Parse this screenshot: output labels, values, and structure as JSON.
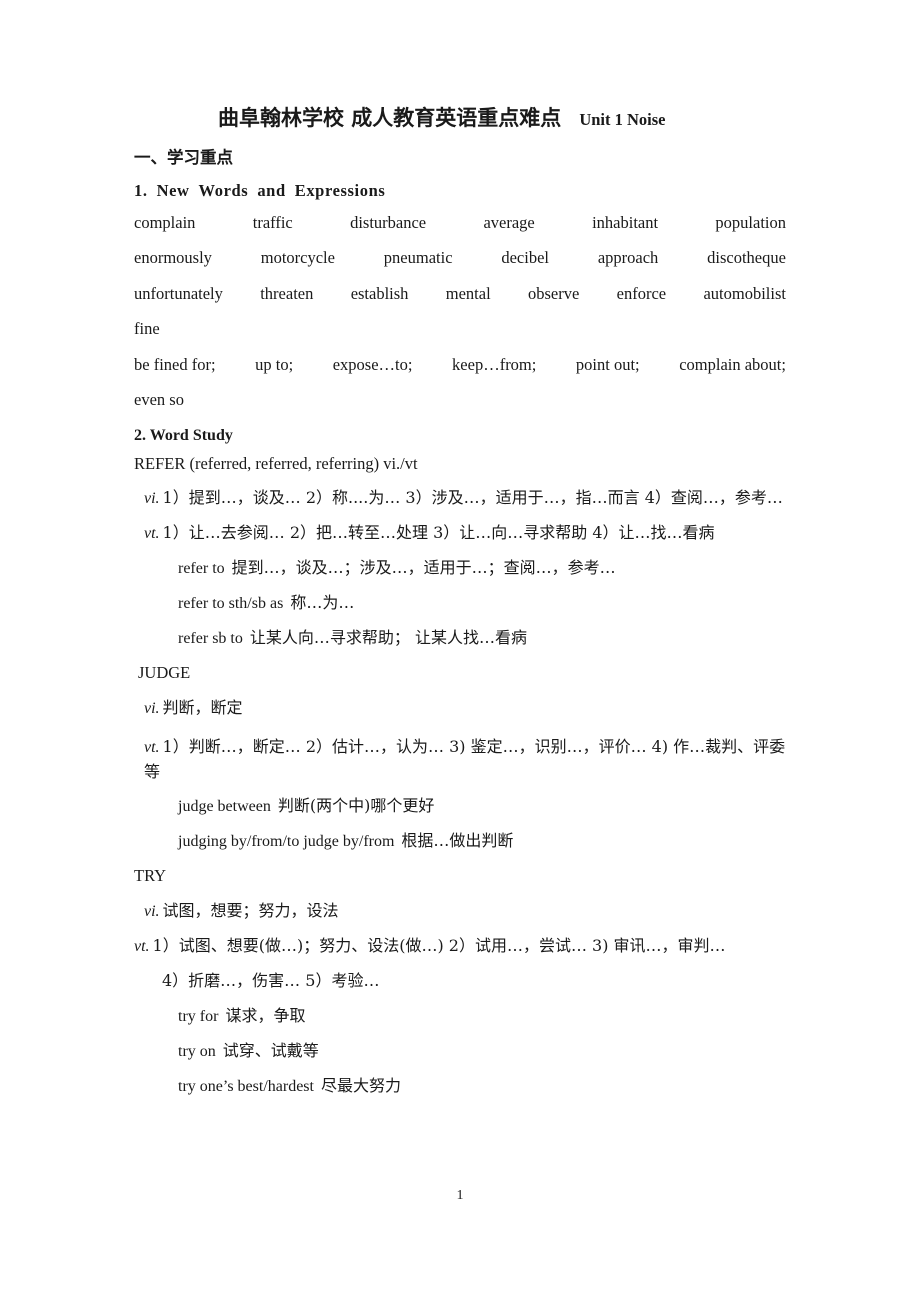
{
  "document": {
    "title_cn": "曲阜翰林学校   成人教育英语重点难点",
    "title_en": "Unit 1 Noise",
    "page_number": "1"
  },
  "section_one": {
    "heading": "一、学习重点",
    "subsection_1_heading_parts": [
      "1.",
      "New",
      "Words",
      "and",
      "Expressions"
    ],
    "word_rows": [
      [
        "complain",
        "traffic",
        "disturbance",
        "average",
        "inhabitant",
        "population"
      ],
      [
        "enormously",
        "motorcycle",
        "pneumatic",
        "decibel",
        "approach",
        "discotheque"
      ],
      [
        "unfortunately",
        "threaten",
        "establish",
        "mental",
        "observe",
        "enforce",
        "automobilist"
      ],
      [
        "fine"
      ]
    ],
    "phrase_rows": [
      [
        "be fined for;",
        "up to;",
        "expose…to;",
        "keep…from;",
        "point out;",
        "complain about;"
      ],
      [
        "even so"
      ]
    ]
  },
  "section_two": {
    "heading": "2. Word Study",
    "entries": [
      {
        "headword": "REFER (referred, referred, referring) vi./vt",
        "senses": [
          {
            "pos": "vi.",
            "text": "1）提到…，谈及… 2）称....为… 3）涉及…，适用于…，指…而言   4）查阅…，参考…"
          },
          {
            "pos": "vt.",
            "text": "1）让…去参阅…   2）把…转至…处理   3）让…向…寻求帮助 4）让…找…看病"
          }
        ],
        "collocations": [
          {
            "en": "refer to",
            "cn": "提到…，谈及…；涉及…，适用于…；查阅…，参考…"
          },
          {
            "en": "refer to sth/sb as",
            "cn": "称…为…"
          },
          {
            "en": "refer sb to",
            "cn": "让某人向…寻求帮助；  让某人找…看病"
          }
        ]
      },
      {
        "headword": "JUDGE",
        "senses": [
          {
            "pos": "vi.",
            "text": "判断，断定"
          },
          {
            "pos": "vt.",
            "text": "1）判断…，断定… 2）估计…，认为… 3) 鉴定…，识别…，评价… 4) 作…裁判、评委等"
          }
        ],
        "collocations": [
          {
            "en": "judge between",
            "cn": "判断(两个中)哪个更好"
          },
          {
            "en": "judging by/from/to judge by/from",
            "cn": "根据…做出判断"
          }
        ]
      },
      {
        "headword": "TRY",
        "senses": [
          {
            "pos": "vi.",
            "text": "试图，想要；努力，设法"
          },
          {
            "pos": "vt.",
            "text": "1）试图、想要(做…)；努力、设法(做…)   2）试用…，尝试… 3) 审讯…，审判…"
          },
          {
            "pos": "",
            "text": "4）折磨…，伤害… 5）考验…"
          }
        ],
        "collocations": [
          {
            "en": "try for",
            "cn": "谋求，争取"
          },
          {
            "en": "try on",
            "cn": "试穿、试戴等"
          },
          {
            "en": "try one’s best/hardest",
            "cn": "尽最大努力"
          }
        ]
      }
    ]
  }
}
